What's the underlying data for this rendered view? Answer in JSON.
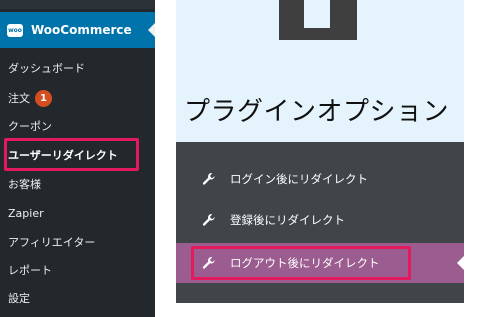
{
  "sidebar": {
    "woocommerce_label": "WooCommerce",
    "logo_text": "woo",
    "items": [
      {
        "label": "ダッシュボード"
      },
      {
        "label": "注文",
        "badge": "1"
      },
      {
        "label": "クーポン"
      },
      {
        "label": "ユーザーリダイレクト"
      },
      {
        "label": "お客様"
      },
      {
        "label": "Zapier"
      },
      {
        "label": "アフィリエイター"
      },
      {
        "label": "レポート"
      },
      {
        "label": "設定"
      }
    ]
  },
  "panel": {
    "title": "プラグインオプション",
    "options": [
      {
        "label": "ログイン後にリダイレクト",
        "icon": "wrench-icon"
      },
      {
        "label": "登録後にリダイレクト",
        "icon": "wrench-icon"
      },
      {
        "label": "ログアウト後にリダイレクト",
        "icon": "wrench-icon"
      }
    ]
  },
  "colors": {
    "sidebar_bg": "#23282d",
    "woo_blue": "#0073aa",
    "highlight": "#e5195e",
    "active_purple": "#9b5c8f",
    "options_bg": "#3f4549",
    "hero_bg": "#e5f4fc"
  }
}
